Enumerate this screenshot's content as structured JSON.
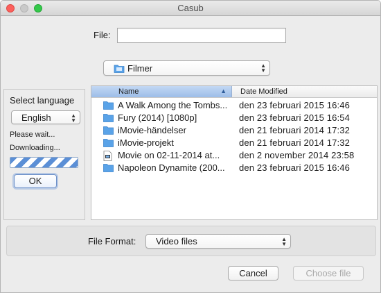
{
  "window": {
    "title": "Casub"
  },
  "file_field": {
    "label": "File:",
    "value": ""
  },
  "folder_popup": {
    "selected": "Filmer",
    "icon": "folder-icon"
  },
  "language_panel": {
    "title": "Select language",
    "selected": "English",
    "status_1": "Please wait...",
    "status_2": "Downloading...",
    "ok_label": "OK"
  },
  "file_list": {
    "columns": {
      "name": "Name",
      "date": "Date Modified"
    },
    "rows": [
      {
        "name": "A Walk Among the Tombs...",
        "date": "den 23 februari 2015 16:46",
        "icon": "folder-icon"
      },
      {
        "name": "Fury (2014) [1080p]",
        "date": "den 23 februari 2015 16:54",
        "icon": "folder-icon"
      },
      {
        "name": "iMovie-händelser",
        "date": "den 21 februari 2014 17:32",
        "icon": "folder-icon"
      },
      {
        "name": "iMovie-projekt",
        "date": "den 21 februari 2014 17:32",
        "icon": "folder-icon"
      },
      {
        "name": "Movie on 02-11-2014 at...",
        "date": "den 2 november 2014 23:58",
        "icon": "video-file-icon"
      },
      {
        "name": "Napoleon Dynamite (200...",
        "date": "den 23 februari 2015 16:46",
        "icon": "folder-icon"
      }
    ]
  },
  "file_format": {
    "label": "File Format:",
    "selected": "Video files"
  },
  "buttons": {
    "cancel": "Cancel",
    "choose": "Choose file"
  },
  "colors": {
    "folder": "#5aa3e8",
    "progress": "#5b8fd6",
    "header_selected": "#9cbde8"
  }
}
